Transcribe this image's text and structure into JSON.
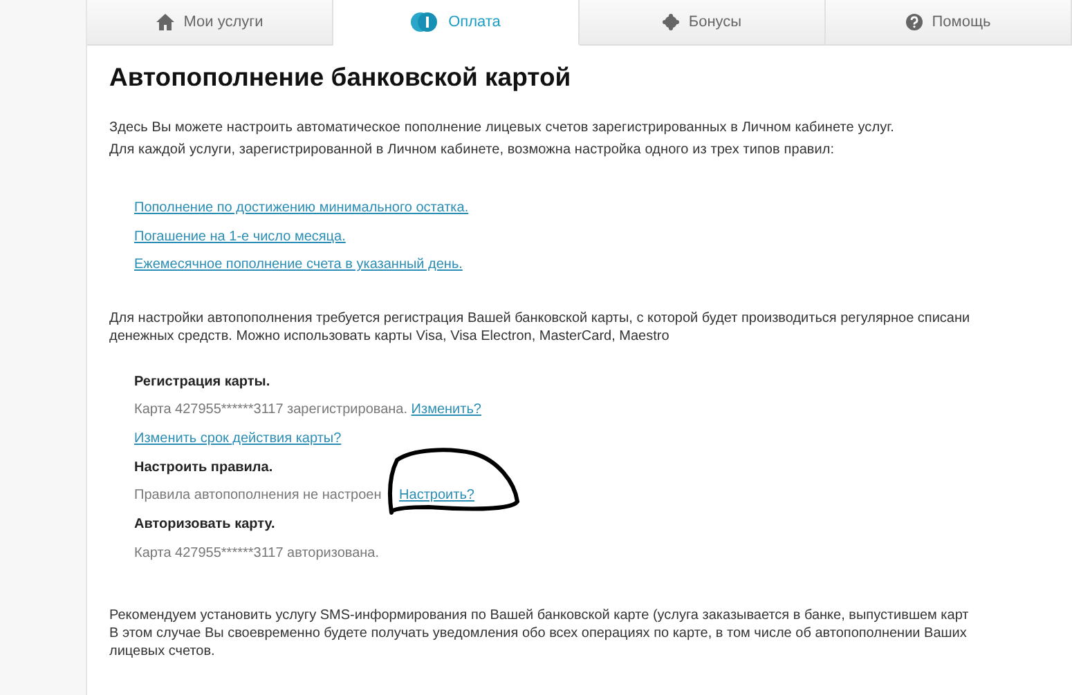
{
  "tabs": [
    {
      "label": "Мои услуги",
      "selected": false
    },
    {
      "label": "Оплата",
      "selected": true
    },
    {
      "label": "Бонусы",
      "selected": false
    },
    {
      "label": "Помощь",
      "selected": false
    }
  ],
  "heading": "Автопополнение банковской картой",
  "intro": [
    "Здесь Вы можете настроить автоматическое пополнение лицевых счетов зарегистрированных в Личном кабинете услуг.",
    "Для каждой услуги, зарегистрированной в Личном кабинете, возможна настройка одного из трех типов правил:"
  ],
  "rule_links": [
    "Пополнение по достижению минимального остатка.",
    "Погашение на 1-е число месяца.",
    "Ежемесячное пополнение счета в указанный день."
  ],
  "requirement": [
    "Для настройки автопополнения требуется регистрация Вашей банковской карты, с которой будет производиться регулярное списани",
    "денежных средств. Можно использовать карты Visa, Visa Electron, MasterCard, Maestro"
  ],
  "steps": [
    {
      "kind": "title",
      "text": "Регистрация карты."
    },
    {
      "kind": "status",
      "text": "Карта 427955******3117 зарегистрирована.",
      "link": "Изменить?"
    },
    {
      "kind": "link",
      "text": "Изменить срок действия карты?"
    },
    {
      "kind": "title",
      "text": "Настроить правила."
    },
    {
      "kind": "status",
      "text": "Правила автопополнения не настроен",
      "link": "Настроить?",
      "circled": true
    },
    {
      "kind": "title",
      "text": "Авторизовать карту."
    },
    {
      "kind": "status",
      "text": "Карта 427955******3117 авторизована."
    }
  ],
  "recommendation": [
    "Рекомендуем установить услугу SMS-информирования по Вашей банковской карте (услуга заказывается в банке, выпустившем карт",
    "В этом случае Вы своевременно будете получать уведомления обо всех операциях по карте, в том числе об автопополнении Ваших",
    "лицевых счетов."
  ]
}
